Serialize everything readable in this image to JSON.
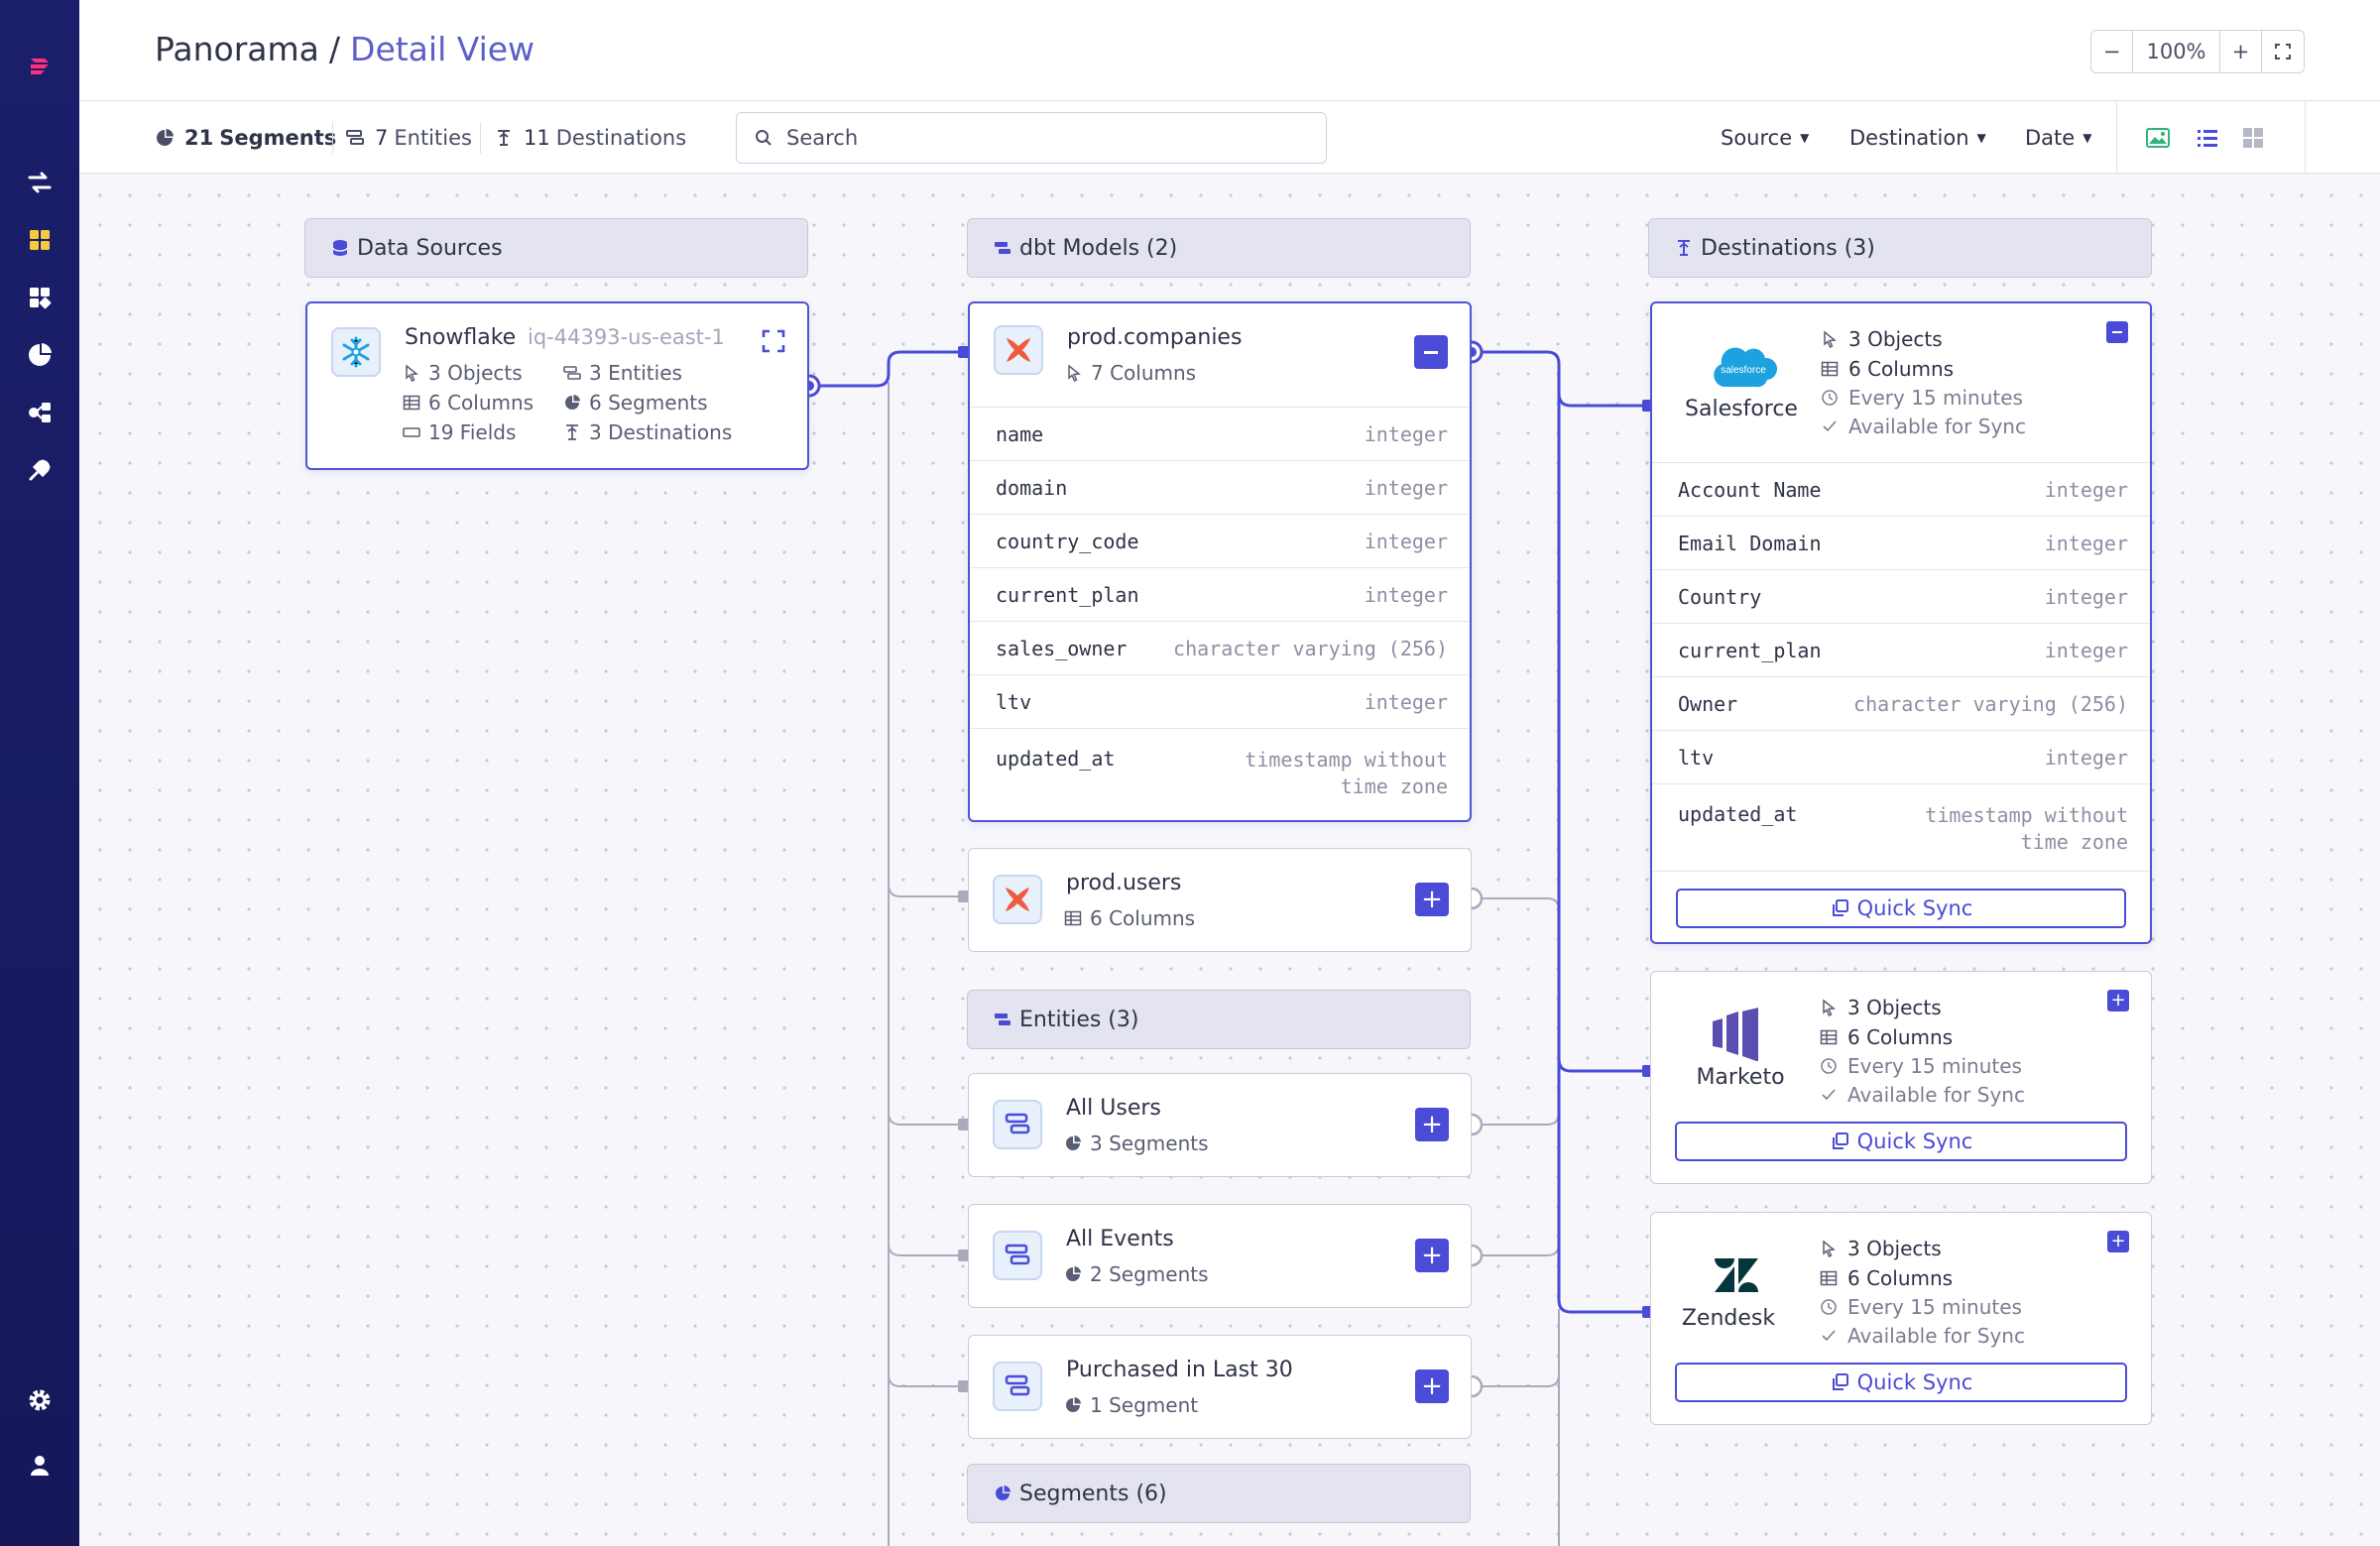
{
  "header": {
    "breadcrumb_root": "Panorama",
    "breadcrumb_separator": "/",
    "breadcrumb_current": "Detail View",
    "zoom_level": "100%",
    "zoom_out": "−",
    "zoom_in": "+"
  },
  "toolbar": {
    "segments_count": "21",
    "segments_label": "Segments",
    "entities_count": "7",
    "entities_label": "Entities",
    "destinations_count": "11",
    "destinations_label": "Destinations",
    "search_placeholder": "Search",
    "filters": [
      "Source",
      "Destination",
      "Date"
    ]
  },
  "groups": {
    "data_sources": "Data Sources",
    "dbt_models": "dbt Models (2)",
    "destinations": "Destinations (3)",
    "entities": "Entities (3)",
    "segments": "Segments (6)"
  },
  "source": {
    "name": "Snowflake",
    "id": "iq-44393-us-east-1",
    "stats": [
      "3 Objects",
      "3 Entities",
      "6 Columns",
      "6 Segments",
      "19 Fields",
      "3 Destinations"
    ]
  },
  "models": [
    {
      "name": "prod.companies",
      "columns_label": "7 Columns",
      "expanded": true,
      "columns": [
        {
          "name": "name",
          "type": "integer"
        },
        {
          "name": "domain",
          "type": "integer"
        },
        {
          "name": "country_code",
          "type": "integer"
        },
        {
          "name": "current_plan",
          "type": "integer"
        },
        {
          "name": "sales_owner",
          "type": "character varying (256)"
        },
        {
          "name": "ltv",
          "type": "integer"
        },
        {
          "name": "updated_at",
          "type": "timestamp without time zone"
        }
      ]
    },
    {
      "name": "prod.users",
      "columns_label": "6 Columns",
      "expanded": false
    }
  ],
  "entities": [
    {
      "name": "All Users",
      "segments": "3 Segments"
    },
    {
      "name": "All Events",
      "segments": "2 Segments"
    },
    {
      "name": "Purchased in Last 30",
      "segments": "1 Segment"
    }
  ],
  "destinations": [
    {
      "name": "Salesforce",
      "logo_text": "salesforce",
      "objects": "3 Objects",
      "columns": "6 Columns",
      "schedule": "Every 15 minutes",
      "status": "Available for Sync",
      "quick_sync": "Quick Sync",
      "expanded": true,
      "fields": [
        {
          "name": "Account Name",
          "type": "integer"
        },
        {
          "name": "Email Domain",
          "type": "integer"
        },
        {
          "name": "Country",
          "type": "integer"
        },
        {
          "name": "current_plan",
          "type": "integer"
        },
        {
          "name": "Owner",
          "type": "character varying (256)"
        },
        {
          "name": "ltv",
          "type": "integer"
        },
        {
          "name": "updated_at",
          "type": "timestamp without time zone"
        }
      ]
    },
    {
      "name": "Marketo",
      "objects": "3 Objects",
      "columns": "6 Columns",
      "schedule": "Every 15 minutes",
      "status": "Available for Sync",
      "quick_sync": "Quick Sync",
      "expanded": false
    },
    {
      "name": "Zendesk",
      "objects": "3 Objects",
      "columns": "6 Columns",
      "schedule": "Every 15 minutes",
      "status": "Available for Sync",
      "quick_sync": "Quick Sync",
      "expanded": false
    }
  ],
  "colors": {
    "accent": "#4a4bd6",
    "sidebar": "#1b1f6b",
    "wire_active": "#4a4bd6",
    "wire_inactive": "#a9abbd",
    "dbt_logo": "#f05a3a",
    "salesforce": "#1ea1e0",
    "marketo": "#5a4fb0",
    "zendesk": "#03363d"
  }
}
